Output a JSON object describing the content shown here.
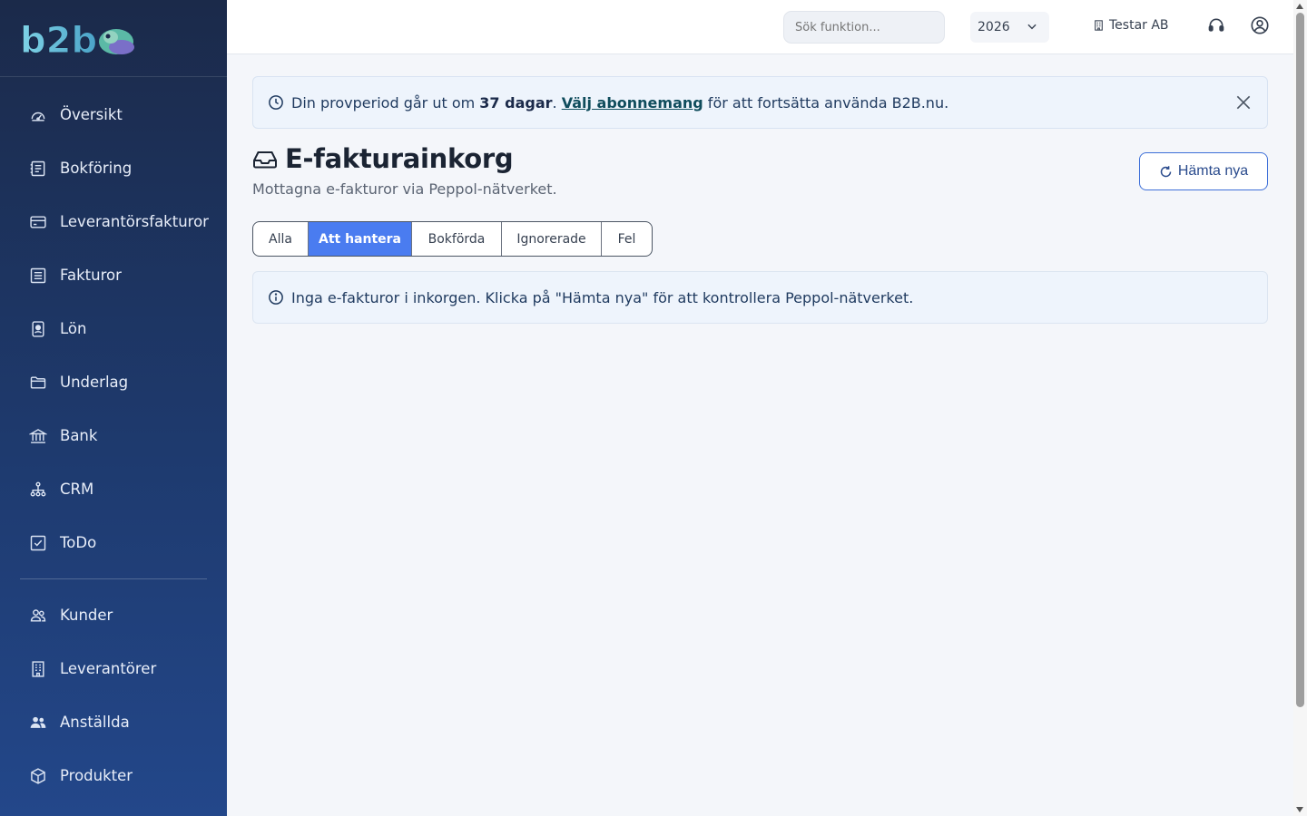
{
  "brand": {
    "logo_text": "b2b"
  },
  "sidebar": {
    "items": [
      {
        "label": "Översikt",
        "icon": "gauge-icon"
      },
      {
        "label": "Bokföring",
        "icon": "ledger-icon"
      },
      {
        "label": "Leverantörsfakturor",
        "icon": "credit-card-icon"
      },
      {
        "label": "Fakturor",
        "icon": "invoice-icon"
      },
      {
        "label": "Lön",
        "icon": "id-badge-icon"
      },
      {
        "label": "Underlag",
        "icon": "folder-icon"
      },
      {
        "label": "Bank",
        "icon": "bank-icon"
      },
      {
        "label": "CRM",
        "icon": "network-icon"
      },
      {
        "label": "ToDo",
        "icon": "checkbox-icon"
      }
    ],
    "secondary_items": [
      {
        "label": "Kunder",
        "icon": "users-icon"
      },
      {
        "label": "Leverantörer",
        "icon": "building-icon"
      },
      {
        "label": "Anställda",
        "icon": "people-icon"
      },
      {
        "label": "Produkter",
        "icon": "box-icon"
      }
    ]
  },
  "topbar": {
    "search_placeholder": "Sök funktion...",
    "year": "2026",
    "company": "Testar AB"
  },
  "banner": {
    "prefix": "Din provperiod går ut om ",
    "days": "37 dagar",
    "sep": ". ",
    "link": "Välj abonnemang",
    "suffix": " för att fortsätta använda B2B.nu."
  },
  "page": {
    "title": "E-fakturainkorg",
    "subtitle": "Mottagna e-fakturor via Peppol-nätverket.",
    "refresh_label": "Hämta nya"
  },
  "tabs": [
    {
      "label": "Alla",
      "active": false
    },
    {
      "label": "Att hantera",
      "active": true
    },
    {
      "label": "Bokförda",
      "active": false
    },
    {
      "label": "Ignorerade",
      "active": false
    },
    {
      "label": "Fel",
      "active": false
    }
  ],
  "info": {
    "message": "Inga e-fakturor i inkorgen. Klicka på \"Hämta nya\" för att kontrollera Peppol-nätverket."
  },
  "colors": {
    "sidebar_top": "#1b2a4a",
    "sidebar_bottom": "#23478a",
    "accent": "#4a7cf0",
    "banner_bg": "#eef4fc"
  }
}
